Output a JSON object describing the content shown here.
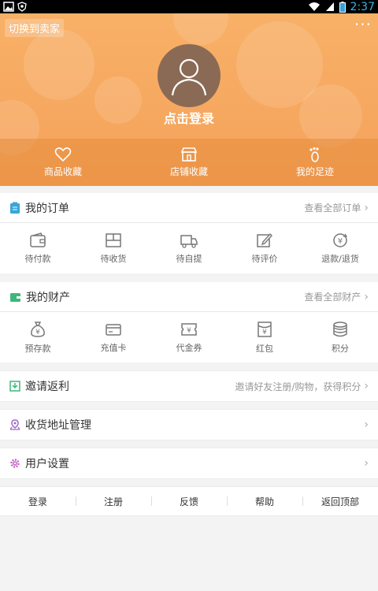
{
  "status_bar": {
    "time": "2:37"
  },
  "header": {
    "switch_seller": "切换到卖家",
    "more": "···",
    "login": "点击登录",
    "tabs": [
      {
        "label": "商品收藏",
        "icon": "heart-icon"
      },
      {
        "label": "店铺收藏",
        "icon": "store-icon"
      },
      {
        "label": "我的足迹",
        "icon": "footprint-icon"
      }
    ]
  },
  "orders": {
    "title": "我的订单",
    "more": "查看全部订单",
    "items": [
      {
        "label": "待付款",
        "icon": "wallet-icon"
      },
      {
        "label": "待收货",
        "icon": "box-icon"
      },
      {
        "label": "待自提",
        "icon": "truck-icon"
      },
      {
        "label": "待评价",
        "icon": "edit-icon"
      },
      {
        "label": "退款/退货",
        "icon": "refund-icon"
      }
    ]
  },
  "assets": {
    "title": "我的财产",
    "more": "查看全部财产",
    "items": [
      {
        "label": "预存款",
        "icon": "moneybag-icon"
      },
      {
        "label": "充值卡",
        "icon": "card-icon"
      },
      {
        "label": "代金券",
        "icon": "coupon-icon"
      },
      {
        "label": "红包",
        "icon": "redpacket-icon"
      },
      {
        "label": "积分",
        "icon": "coins-icon"
      }
    ]
  },
  "invite": {
    "title": "邀请返利",
    "hint": "邀请好友注册/购物，获得积分"
  },
  "address": {
    "title": "收货地址管理"
  },
  "settings": {
    "title": "用户设置"
  },
  "footer": {
    "links": [
      "登录",
      "注册",
      "反馈",
      "帮助",
      "返回顶部"
    ]
  },
  "colors": {
    "header": "#f5a25a",
    "accent_blue": "#35b5e5",
    "icon_gray": "#777777"
  }
}
